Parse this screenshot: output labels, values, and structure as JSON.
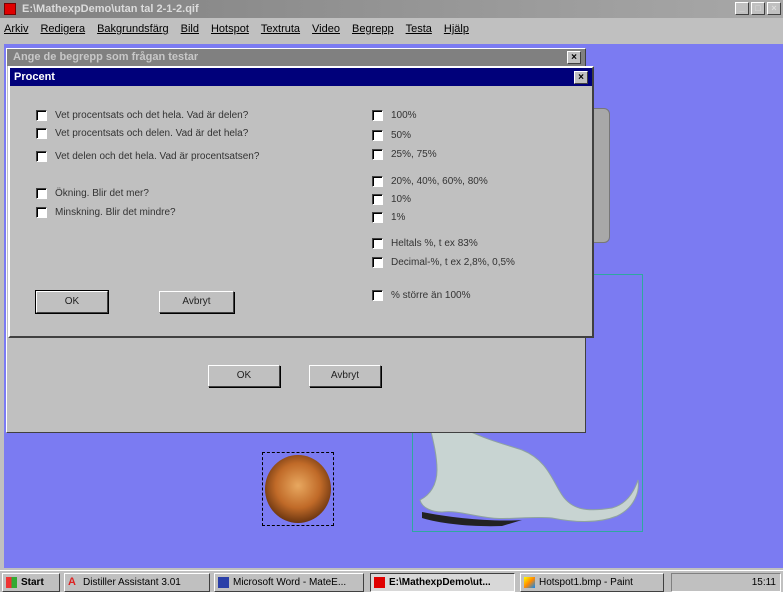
{
  "app": {
    "title": "E:\\MathexpDemo\\utan tal 2-1-2.qif",
    "window_buttons": [
      "_",
      "□",
      "×"
    ]
  },
  "menu": [
    "Arkiv",
    "Redigera",
    "Bakgrundsfärg",
    "Bild",
    "Hotspot",
    "Textruta",
    "Video",
    "Begrepp",
    "Testa",
    "Hjälp"
  ],
  "back_dialog": {
    "title": "Ange de begrepp som frågan testar",
    "ok_label": "OK",
    "cancel_label": "Avbryt"
  },
  "dialog": {
    "title": "Procent",
    "left_options": [
      "Vet procentsats och det hela. Vad är delen?",
      "Vet procentsats och delen. Vad är det hela?",
      "Vet delen och det hela. Vad är procentsatsen?",
      "Ökning. Blir det mer?",
      "Minskning. Blir det mindre?"
    ],
    "right_options": [
      "100%",
      "50%",
      "25%, 75%",
      "20%, 40%, 60%, 80%",
      "10%",
      "1%",
      "Heltals %, t ex 83%",
      "Decimal-%, t ex 2,8%, 0,5%",
      "% större än 100%"
    ],
    "ok_label": "OK",
    "cancel_label": "Avbryt"
  },
  "taskbar": {
    "start_label": "Start",
    "items": [
      "Distiller Assistant 3.01",
      "Microsoft Word - MateE...",
      "E:\\MathexpDemo\\ut...",
      "Hotspot1.bmp - Paint"
    ],
    "clock": "15:11"
  }
}
